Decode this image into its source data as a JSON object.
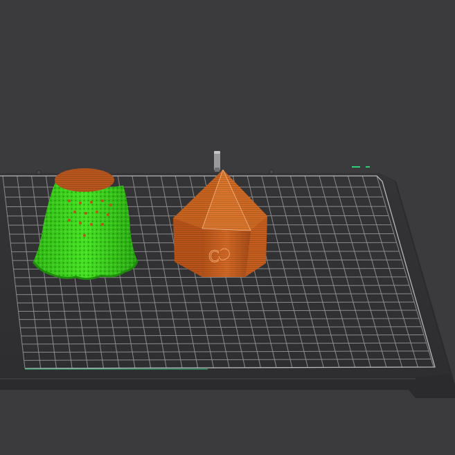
{
  "viewport": {
    "background_color": "#3b3b3d",
    "bed_color": "#333335",
    "bed_edge_color": "#29292b",
    "grid_color": "#8a8a8d",
    "bed_outline_color": "#b5b5b8"
  },
  "objects": [
    {
      "name": "green-model",
      "shell_color": "#3ad41c",
      "top_color": "#b9561e",
      "state": "selected"
    },
    {
      "name": "orange-model",
      "shell_color": "#c9601f",
      "top_color": "#d8742c",
      "emboss_text": "C"
    }
  ],
  "nozzle": {
    "color": "#9a9a9c"
  }
}
